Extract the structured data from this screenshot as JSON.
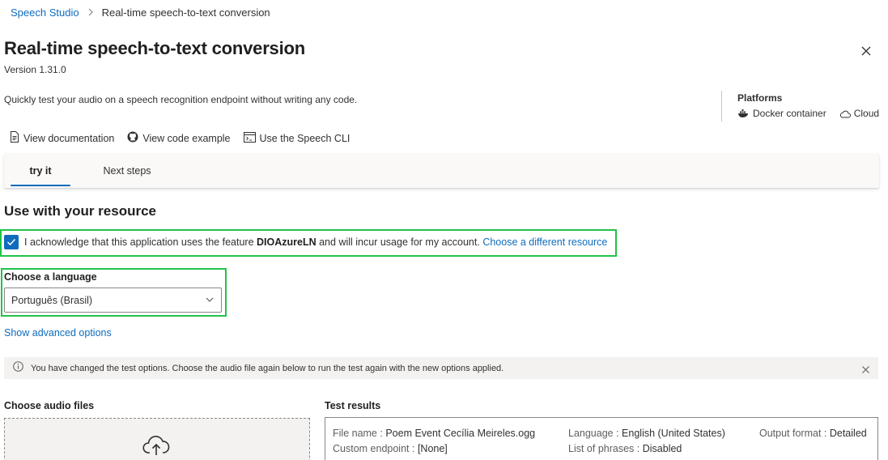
{
  "breadcrumb": {
    "root": "Speech Studio",
    "current": "Real-time speech-to-text conversion"
  },
  "header": {
    "title": "Real-time speech-to-text conversion",
    "version": "Version 1.31.0"
  },
  "description": "Quickly test your audio on a speech recognition endpoint without writing any code.",
  "platforms": {
    "title": "Platforms",
    "items": [
      "Docker container",
      "Cloud"
    ]
  },
  "links": [
    "View documentation",
    "View code example",
    "Use the Speech CLI"
  ],
  "tabs": [
    {
      "label": "try it",
      "active": true
    },
    {
      "label": "Next steps",
      "active": false
    }
  ],
  "resource": {
    "title": "Use with your resource",
    "ack_prefix": "I acknowledge that this application uses the feature",
    "resource_name": "DIOAzureLN",
    "ack_suffix": "and will incur usage for my account.",
    "change_link": "Choose a different resource",
    "checked": true
  },
  "language": {
    "label": "Choose a language",
    "selected": "Português (Brasil)"
  },
  "advanced_link": "Show advanced options",
  "message_bar": "You have changed the test options. Choose the audio file again below to run the test again with the new options applied.",
  "audio": {
    "label": "Choose audio files"
  },
  "results": {
    "label": "Test results",
    "file_name_key": "File name :",
    "file_name": "Poem Event Cecília Meireles.ogg",
    "custom_endpoint_key": "Custom endpoint :",
    "custom_endpoint": "[None]",
    "language_key": "Language :",
    "language": "English (United States)",
    "phrases_key": "List of phrases :",
    "phrases": "Disabled",
    "output_key": "Output format :",
    "output": "Detailed"
  },
  "colors": {
    "accent": "#0f6cbd",
    "highlight_border": "#22c34a",
    "message_bg": "#f3f2f1"
  },
  "icons": [
    "chevron-right-icon",
    "close-icon",
    "docker-icon",
    "cloud-icon",
    "document-icon",
    "github-icon",
    "terminal-icon",
    "checkmark-icon",
    "chevron-down-icon",
    "info-icon",
    "upload-cloud-icon"
  ]
}
